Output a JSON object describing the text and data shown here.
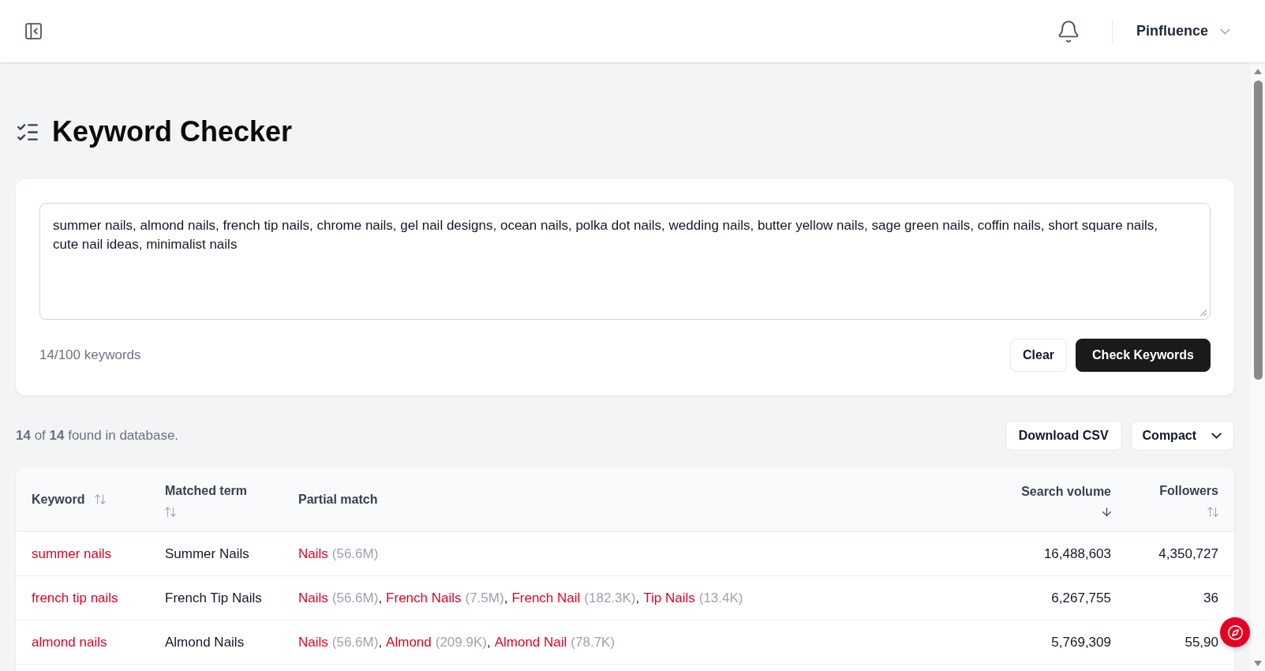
{
  "header": {
    "account": {
      "name": "Pinfluence"
    }
  },
  "page_title": "Keyword Checker",
  "keyword_input": {
    "value": "summer nails, almond nails, french tip nails, chrome nails, gel nail designs, ocean nails, polka dot nails, wedding nails, butter yellow nails, sage green nails, coffin nails, short square nails, cute nail ideas, minimalist nails",
    "count": "14/100 keywords",
    "buttons": [
      {
        "label": "Clear",
        "kind": "secondary"
      },
      {
        "label": "Check Keywords",
        "kind": "primary"
      }
    ]
  },
  "results": {
    "summary": "**14** of **14** found in database.",
    "actions": [
      {
        "label": "Download CSV",
        "kind": "button"
      },
      {
        "label": "Compact",
        "kind": "dropdown"
      }
    ],
    "table": {
      "columns": [
        {
          "label": "Keyword",
          "kind": "text",
          "sortable": true,
          "sorted": false
        },
        {
          "label": "Matched term",
          "kind": "text",
          "sortable": true,
          "sorted": false
        },
        {
          "label": "Partial match",
          "kind": "text",
          "sortable": false
        },
        {
          "label": "Search volume",
          "kind": "number",
          "sortable": true,
          "sorted": true
        },
        {
          "label": "Followers",
          "kind": "number",
          "sortable": true,
          "sorted": false
        }
      ],
      "rows": [
        {
          "keyword": "summer nails",
          "matched_term": "Summer Nails",
          "partial_matches": [
            {
              "term": "Nails",
              "volume": "(56.6M)"
            }
          ],
          "search_volume": "16,488,603",
          "followers": "4,350,727"
        },
        {
          "keyword": "french tip nails",
          "matched_term": "French Tip Nails",
          "partial_matches": [
            {
              "term": "Nails",
              "volume": "(56.6M)",
              "separator": ","
            },
            {
              "term": "French Nails",
              "volume": "(7.5M)",
              "separator": ","
            },
            {
              "term": "French Nail",
              "volume": "(182.3K)",
              "separator": ","
            },
            {
              "term": "Tip Nails",
              "volume": "(13.4K)"
            }
          ],
          "search_volume": "6,267,755",
          "followers": "36"
        },
        {
          "keyword": "almond nails",
          "matched_term": "Almond Nails",
          "partial_matches": [
            {
              "term": "Nails",
              "volume": "(56.6M)",
              "separator": ","
            },
            {
              "term": "Almond",
              "volume": "(209.9K)",
              "separator": ","
            },
            {
              "term": "Almond Nail",
              "volume": "(78.7K)"
            }
          ],
          "search_volume": "5,769,309",
          "followers": "55,90"
        }
      ]
    }
  }
}
